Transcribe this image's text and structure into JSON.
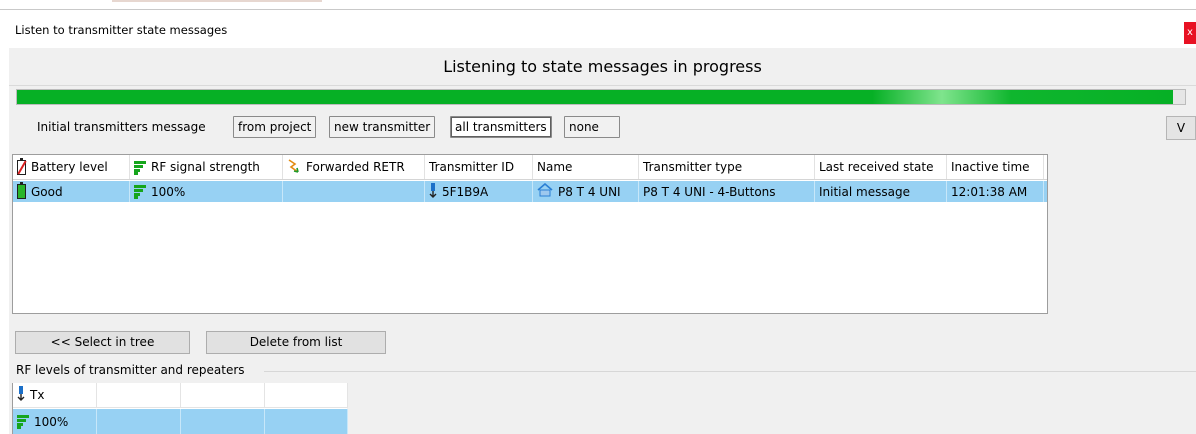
{
  "window": {
    "title": "Listen to transmitter state messages",
    "close_glyph": "x"
  },
  "status": {
    "banner": "Listening to state messages in progress",
    "progress": 0.99
  },
  "filter": {
    "label": "Initial transmitters message",
    "buttons": [
      "from project",
      "new transmitter",
      "all transmitters",
      "none"
    ],
    "selected": "all transmitters",
    "v_label": "V"
  },
  "table": {
    "columns": [
      {
        "label": "Battery level",
        "icon": "battery-icon"
      },
      {
        "label": "RF signal strength",
        "icon": "signal-strength-icon"
      },
      {
        "label": "Forwarded RETR",
        "icon": "forwarded-retr-icon"
      },
      {
        "label": "Transmitter ID"
      },
      {
        "label": "Name"
      },
      {
        "label": "Transmitter type"
      },
      {
        "label": "Last received state"
      },
      {
        "label": "Inactive time"
      }
    ],
    "rows": [
      {
        "battery": "Good",
        "rf_strength": "100%",
        "forwarded": "",
        "transmitter_id": "5F1B9A",
        "name": "P8 T 4 UNI",
        "type": "P8 T 4 UNI - 4-Buttons",
        "last_state": "Initial message",
        "inactive_time": "12:01:38 AM"
      }
    ]
  },
  "actions": {
    "select_in_tree": "<< Select in tree",
    "delete_from_list": "Delete from list"
  },
  "rf_levels": {
    "title": "RF levels of transmitter and repeaters",
    "header": [
      "Tx",
      "",
      "",
      ""
    ],
    "row": [
      "100%",
      "",
      "",
      ""
    ]
  },
  "colors": {
    "selection": "#97d1f3",
    "progress": "#06b025",
    "close": "#e81123"
  }
}
